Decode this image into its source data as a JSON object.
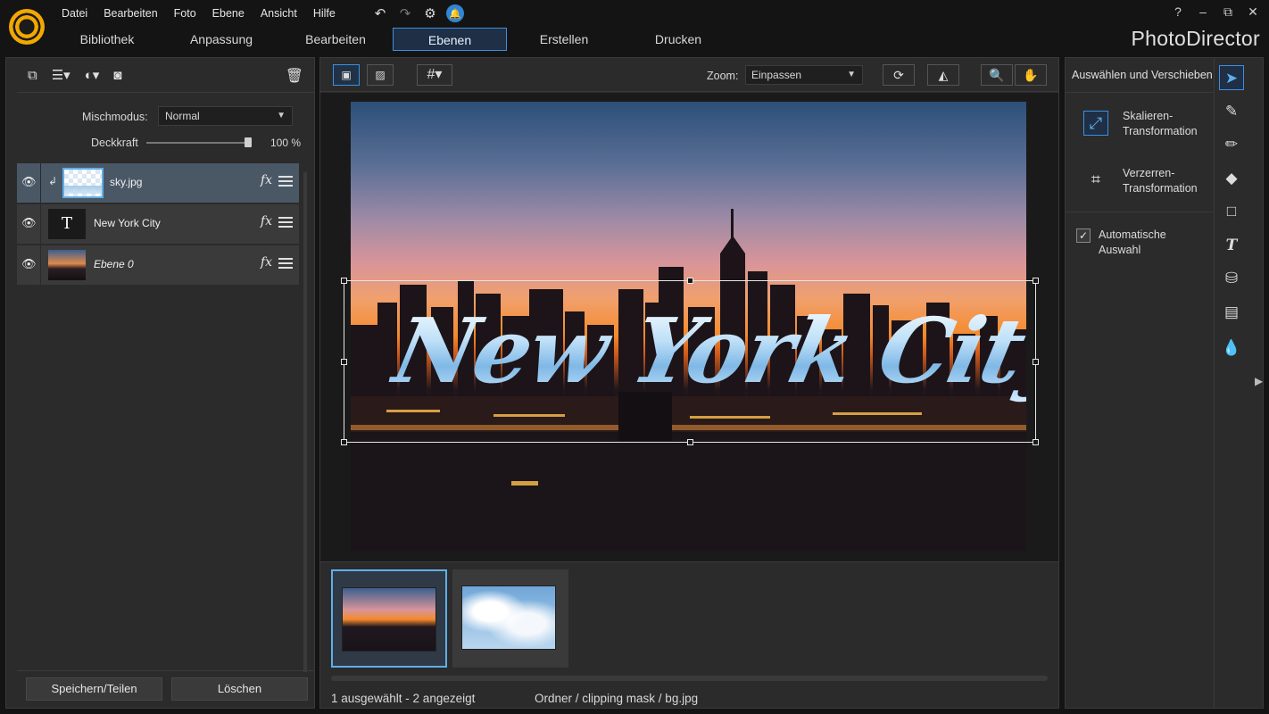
{
  "app": {
    "brand": "PhotoDirector",
    "menu": [
      "Datei",
      "Bearbeiten",
      "Foto",
      "Ebene",
      "Ansicht",
      "Hilfe"
    ],
    "window_controls": [
      "?",
      "–",
      "⧉",
      "✕"
    ],
    "tabs": [
      {
        "label": "Bibliothek",
        "active": false
      },
      {
        "label": "Anpassung",
        "active": false
      },
      {
        "label": "Bearbeiten",
        "active": false
      },
      {
        "label": "Ebenen",
        "active": true
      },
      {
        "label": "Erstellen",
        "active": false
      },
      {
        "label": "Drucken",
        "active": false
      }
    ],
    "accent_color": "#3c8fe0",
    "logo_color": "#f2a800"
  },
  "layers_panel": {
    "blend_label": "Mischmodus:",
    "blend_value": "Normal",
    "opacity_label": "Deckkraft",
    "opacity_value": "100 %",
    "opacity_fraction": 1.0,
    "layers": [
      {
        "name": "sky.jpg",
        "selected": true,
        "clipped": true,
        "thumb": "transparent-sky"
      },
      {
        "name": "New York City",
        "selected": false,
        "clipped": false,
        "thumb": "text-T"
      },
      {
        "name": "Ebene 0",
        "selected": false,
        "clipped": false,
        "thumb": "city-photo"
      }
    ],
    "fx_label": "fx",
    "save_button": "Speichern/Teilen",
    "delete_button": "Löschen"
  },
  "viewer": {
    "zoom_label": "Zoom:",
    "zoom_value": "Einpassen",
    "canvas_text": "New York City",
    "status_selected": "1 ausgewählt - 2 angezeigt",
    "status_path": "Ordner / clipping mask / bg.jpg",
    "filmstrip": [
      {
        "name": "bg.jpg",
        "selected": true
      },
      {
        "name": "sky.jpg",
        "selected": false
      }
    ]
  },
  "tool_panel": {
    "title": "Auswählen und Verschieben",
    "option_scale": "Skalieren-\nTransformation",
    "option_distort": "Verzerren-\nTransformation",
    "auto_select": "Automatische\nAuswahl",
    "auto_select_checked": true,
    "tools": [
      "select-arrow-icon",
      "brush-selection-icon",
      "pencil-icon",
      "eraser-icon",
      "rectangle-icon",
      "text-icon",
      "fill-bucket-icon",
      "gradient-icon",
      "blur-drop-icon"
    ]
  }
}
